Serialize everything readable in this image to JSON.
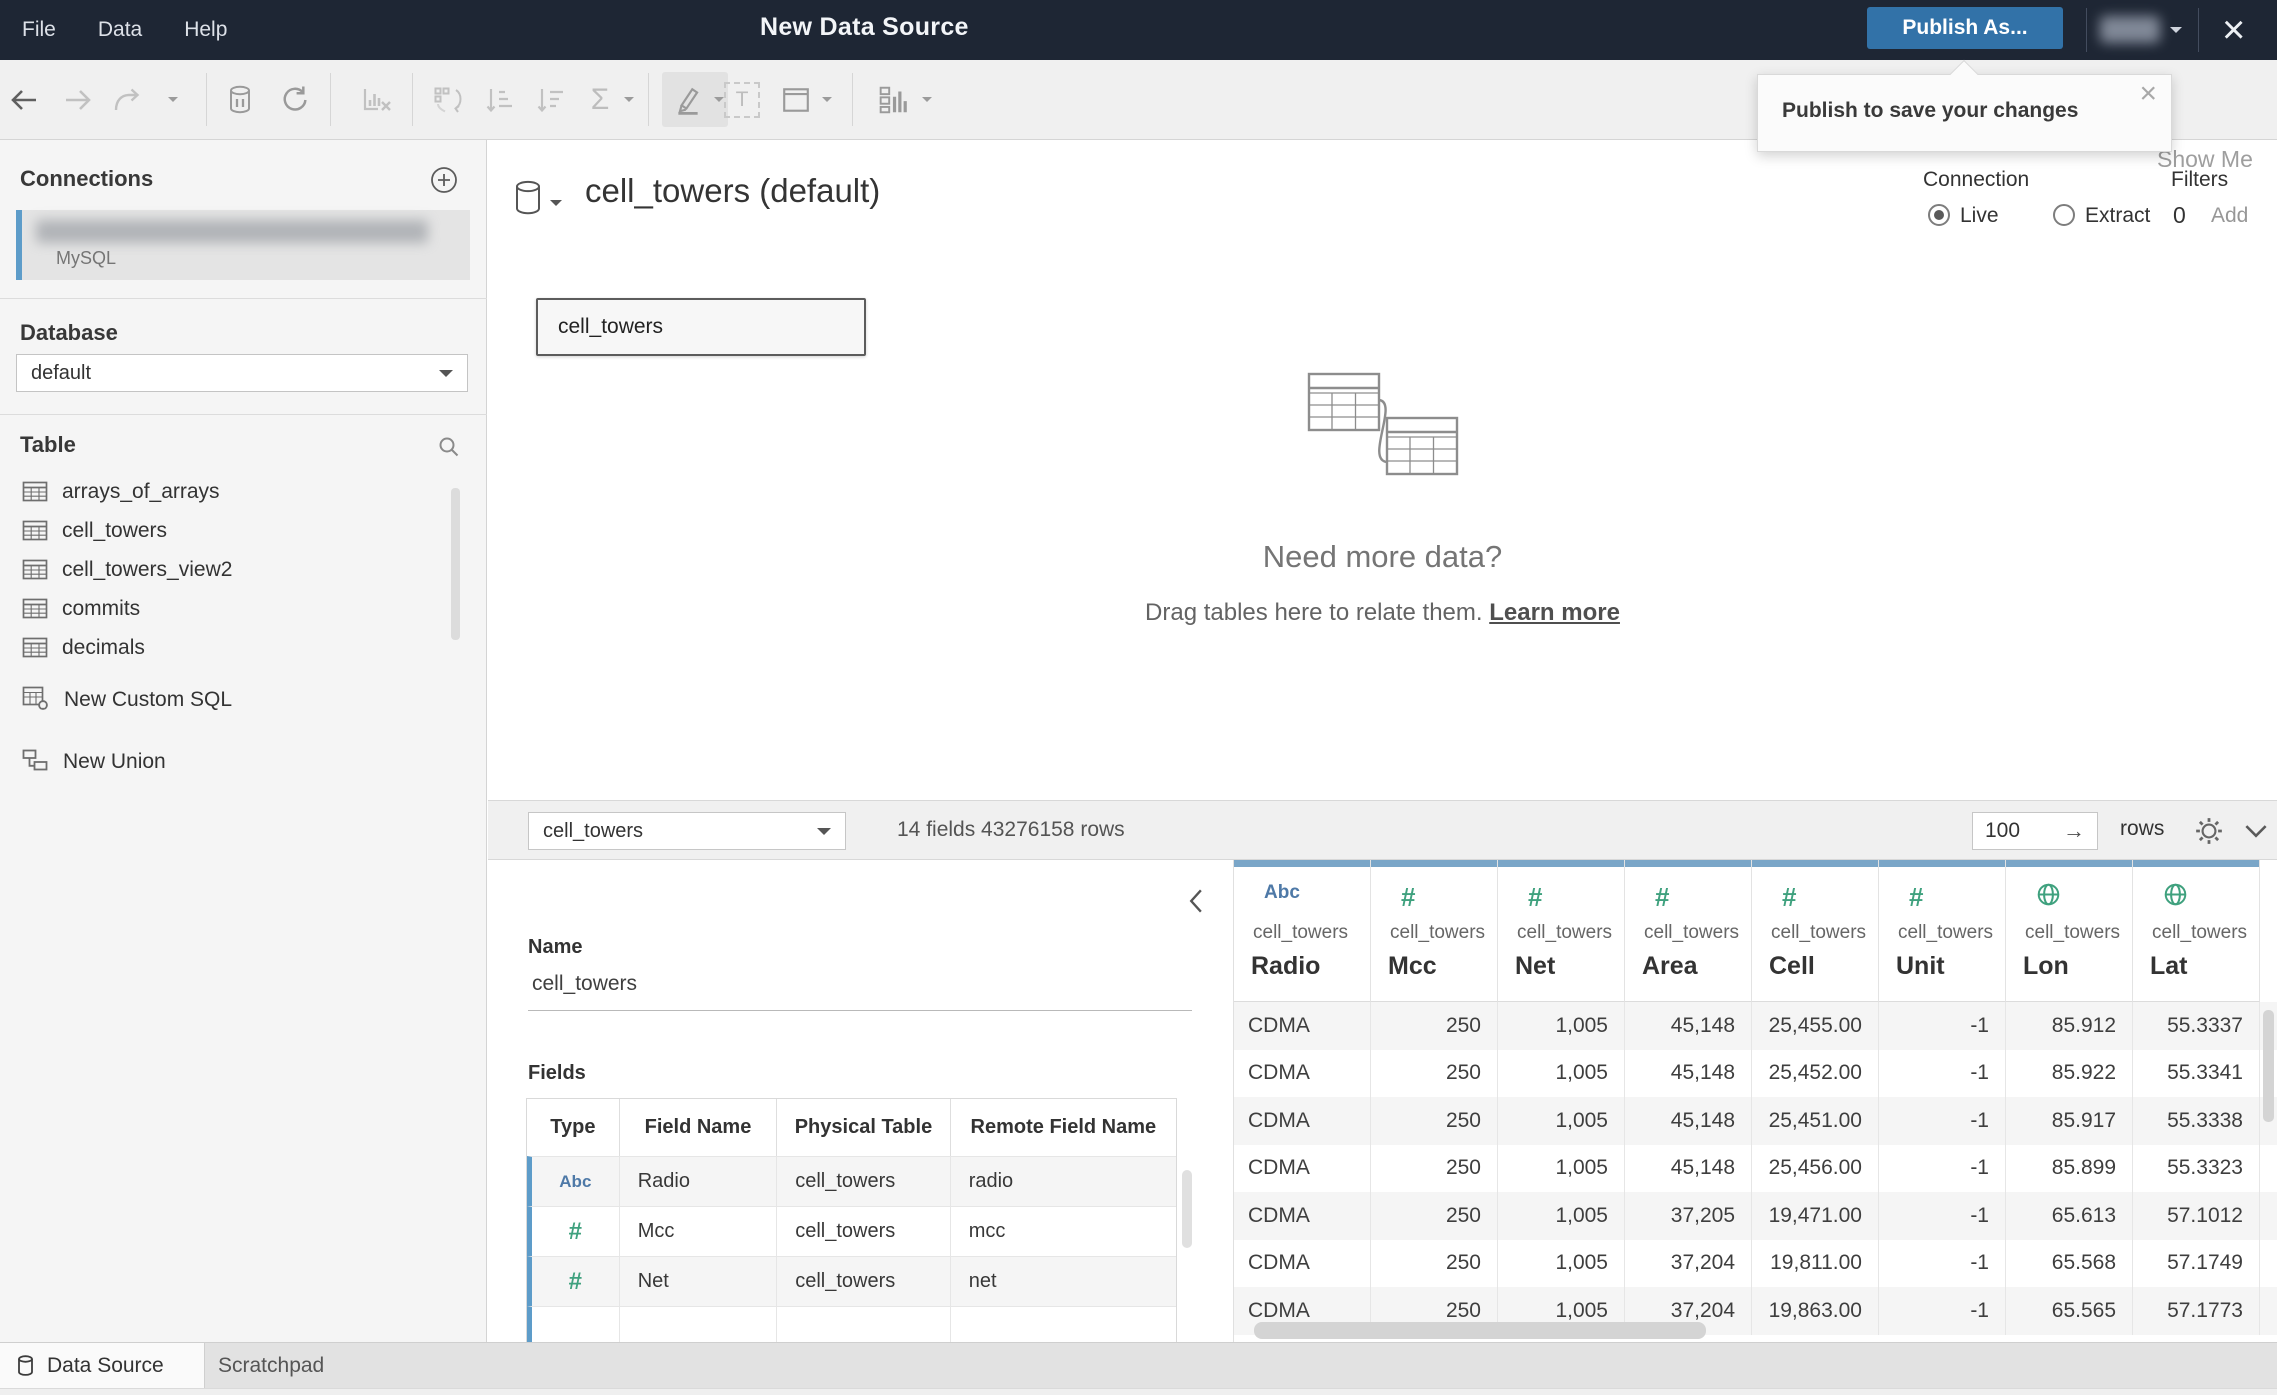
{
  "window": {
    "menus": [
      "File",
      "Data",
      "Help"
    ],
    "title": "New Data Source",
    "publish_button": "Publish As...",
    "close_icon": "×",
    "tooltip": {
      "text": "Publish to save your changes",
      "close_icon": "×"
    }
  },
  "toolbar": {
    "icons": [
      "back",
      "forward",
      "redo",
      "data-source",
      "refresh",
      "clear-sheet",
      "swap",
      "sort-ascending",
      "sort-descending",
      "totals",
      "highlight",
      "text-box",
      "fit",
      "show-me-panel"
    ],
    "show_me": "Show Me"
  },
  "sidebar": {
    "connections_title": "Connections",
    "connection": {
      "type": "MySQL"
    },
    "database_label": "Database",
    "database_value": "default",
    "table_label": "Table",
    "tables": [
      "arrays_of_arrays",
      "cell_towers",
      "cell_towers_view2",
      "commits",
      "decimals"
    ],
    "new_custom_sql": "New Custom SQL",
    "new_union": "New Union"
  },
  "canvas": {
    "datasource_title": "cell_towers (default)",
    "connection_label": "Connection",
    "live_label": "Live",
    "extract_label": "Extract",
    "filters_label": "Filters",
    "filters_count": "0",
    "filters_add": "Add",
    "table_node_label": "cell_towers",
    "empty_heading": "Need more data?",
    "empty_body": "Drag tables here to relate them.",
    "empty_link": "Learn more"
  },
  "metabar": {
    "table_selector": "cell_towers",
    "info": "14 fields 43276158 rows",
    "row_limit": "100",
    "rows_label": "rows"
  },
  "details": {
    "name_label": "Name",
    "name_value": "cell_towers",
    "fields_label": "Fields",
    "columns": [
      "Type",
      "Field Name",
      "Physical Table",
      "Remote Field Name"
    ],
    "rows": [
      {
        "type": "string",
        "field": "Radio",
        "table": "cell_towers",
        "remote": "radio"
      },
      {
        "type": "number",
        "field": "Mcc",
        "table": "cell_towers",
        "remote": "mcc"
      },
      {
        "type": "number",
        "field": "Net",
        "table": "cell_towers",
        "remote": "net"
      }
    ]
  },
  "grid": {
    "columns": [
      {
        "type": "string",
        "table": "cell_towers",
        "name": "Radio"
      },
      {
        "type": "number",
        "table": "cell_towers",
        "name": "Mcc"
      },
      {
        "type": "number",
        "table": "cell_towers",
        "name": "Net"
      },
      {
        "type": "number",
        "table": "cell_towers",
        "name": "Area"
      },
      {
        "type": "number",
        "table": "cell_towers",
        "name": "Cell"
      },
      {
        "type": "number",
        "table": "cell_towers",
        "name": "Unit"
      },
      {
        "type": "geo",
        "table": "cell_towers",
        "name": "Lon"
      },
      {
        "type": "geo",
        "table": "cell_towers",
        "name": "Lat"
      }
    ],
    "rows": [
      [
        "CDMA",
        "250",
        "1,005",
        "45,148",
        "25,455.00",
        "-1",
        "85.912",
        "55.3337"
      ],
      [
        "CDMA",
        "250",
        "1,005",
        "45,148",
        "25,452.00",
        "-1",
        "85.922",
        "55.3341"
      ],
      [
        "CDMA",
        "250",
        "1,005",
        "45,148",
        "25,451.00",
        "-1",
        "85.917",
        "55.3338"
      ],
      [
        "CDMA",
        "250",
        "1,005",
        "45,148",
        "25,456.00",
        "-1",
        "85.899",
        "55.3323"
      ],
      [
        "CDMA",
        "250",
        "1,005",
        "37,205",
        "19,471.00",
        "-1",
        "65.613",
        "57.1012"
      ],
      [
        "CDMA",
        "250",
        "1,005",
        "37,204",
        "19,811.00",
        "-1",
        "65.568",
        "57.1749"
      ],
      [
        "CDMA",
        "250",
        "1,005",
        "37,204",
        "19,863.00",
        "-1",
        "65.565",
        "57.1773"
      ]
    ]
  },
  "tabs": {
    "data_source": "Data Source",
    "scratchpad": "Scratchpad"
  },
  "colors": {
    "titlebar": "#1e2634",
    "accent_blue": "#3272a8",
    "header_strip": "#7aa6c8",
    "type_blue": "#4e79a7",
    "type_green": "#3fa17e",
    "connection_bar": "#5d9cc9"
  }
}
